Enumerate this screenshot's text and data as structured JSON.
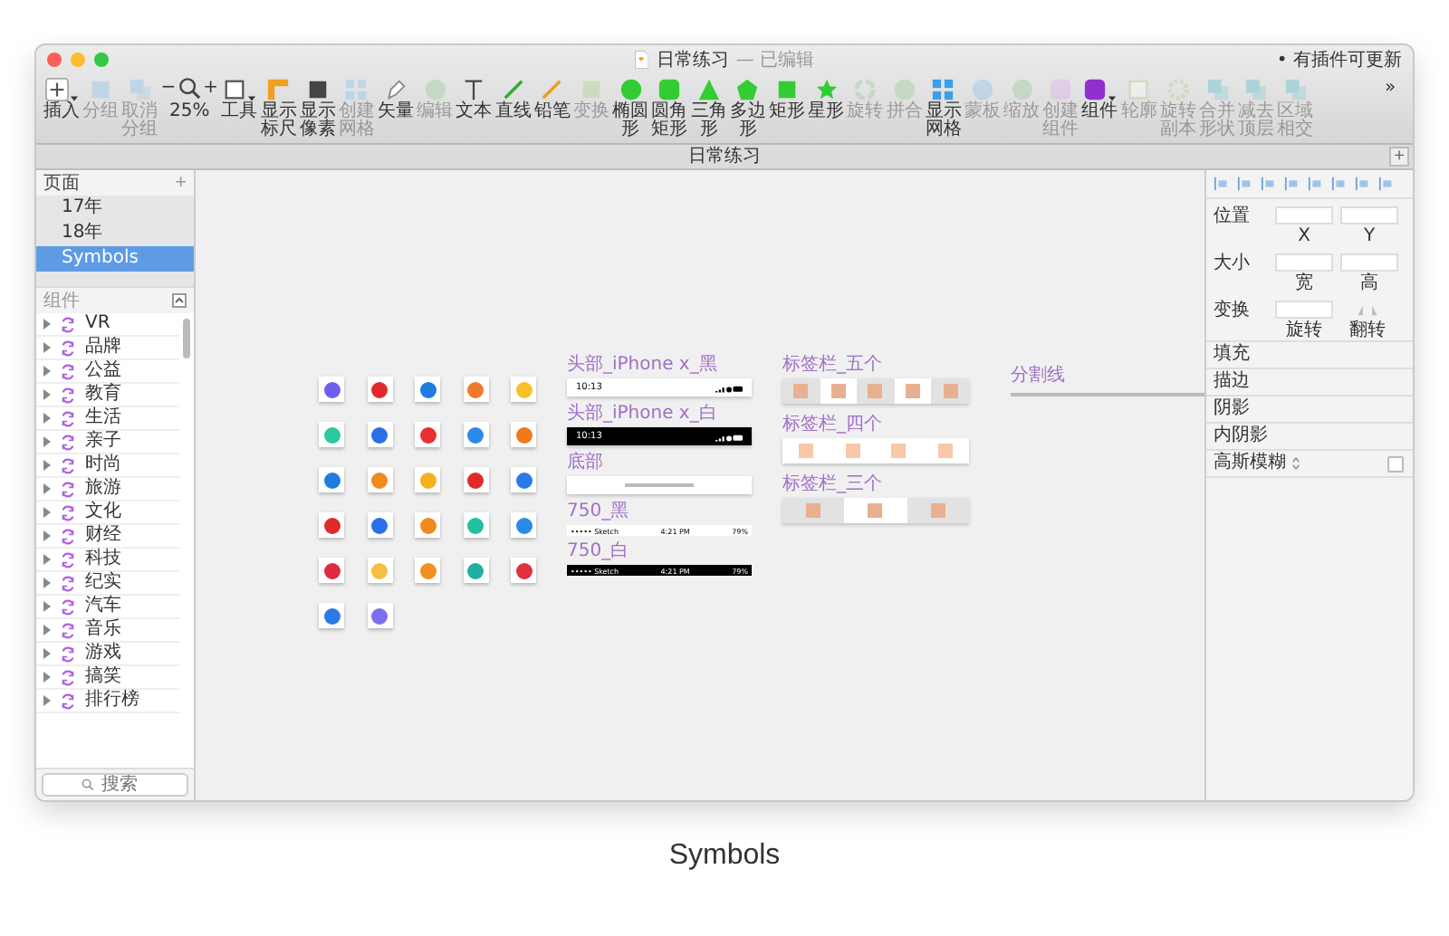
{
  "window": {
    "title": "日常练习",
    "status": "— 已编辑",
    "notice": "• 有插件可更新"
  },
  "toolbar": {
    "items": [
      {
        "kind": "insert",
        "label": "插入",
        "disabled": false,
        "has_menu": true
      },
      {
        "kind": "group",
        "label": "分组",
        "disabled": true,
        "has_menu": false
      },
      {
        "kind": "ungroup",
        "label": "取消分组",
        "disabled": true,
        "has_menu": false
      },
      {
        "kind": "zoom",
        "label": "25%",
        "minus": "−",
        "plus": "+",
        "disabled": false,
        "has_menu": false
      },
      {
        "kind": "tools",
        "label": "工具",
        "disabled": false,
        "has_menu": true
      },
      {
        "kind": "ruler",
        "label": "显示标尺",
        "disabled": false,
        "has_menu": false
      },
      {
        "kind": "pixels",
        "label": "显示像素",
        "disabled": false,
        "has_menu": false
      },
      {
        "kind": "grid",
        "label": "创建网格",
        "disabled": true,
        "has_menu": false
      },
      {
        "kind": "vector",
        "label": "矢量",
        "disabled": false,
        "has_menu": false
      },
      {
        "kind": "edit",
        "label": "编辑",
        "disabled": true,
        "has_menu": false
      },
      {
        "kind": "text",
        "label": "文本",
        "disabled": false,
        "has_menu": false
      },
      {
        "kind": "line",
        "label": "直线",
        "disabled": false,
        "has_menu": false
      },
      {
        "kind": "pencil",
        "label": "铅笔",
        "disabled": false,
        "has_menu": false
      },
      {
        "kind": "transform",
        "label": "变换",
        "disabled": true,
        "has_menu": false
      },
      {
        "kind": "oval",
        "label": "椭圆形",
        "disabled": false,
        "has_menu": false
      },
      {
        "kind": "rounded-rect",
        "label": "圆角矩形",
        "disabled": false,
        "has_menu": false
      },
      {
        "kind": "triangle",
        "label": "三角形",
        "disabled": false,
        "has_menu": false
      },
      {
        "kind": "polygon",
        "label": "多边形",
        "disabled": false,
        "has_menu": false
      },
      {
        "kind": "rect",
        "label": "矩形",
        "disabled": false,
        "has_menu": false
      },
      {
        "kind": "star",
        "label": "星形",
        "disabled": false,
        "has_menu": false
      },
      {
        "kind": "rotate",
        "label": "旋转",
        "disabled": true,
        "has_menu": false
      },
      {
        "kind": "flatten",
        "label": "拼合",
        "disabled": true,
        "has_menu": false
      },
      {
        "kind": "show-grid",
        "label": "显示网格",
        "disabled": false,
        "has_menu": false
      },
      {
        "kind": "mask",
        "label": "蒙板",
        "disabled": true,
        "has_menu": false
      },
      {
        "kind": "scale",
        "label": "缩放",
        "disabled": true,
        "has_menu": false
      },
      {
        "kind": "create-symbol",
        "label": "创建组件",
        "disabled": true,
        "has_menu": false
      },
      {
        "kind": "symbol",
        "label": "组件",
        "disabled": false,
        "has_menu": true
      },
      {
        "kind": "outline",
        "label": "轮廓",
        "disabled": true,
        "has_menu": false
      },
      {
        "kind": "rotate-copy",
        "label": "旋转副本",
        "disabled": true,
        "has_menu": false
      },
      {
        "kind": "union",
        "label": "合并形状",
        "disabled": true,
        "has_menu": false
      },
      {
        "kind": "subtract",
        "label": "减去顶层",
        "disabled": true,
        "has_menu": false
      },
      {
        "kind": "intersect",
        "label": "区域相交",
        "disabled": true,
        "has_menu": false
      }
    ],
    "overflow": "»"
  },
  "document_tab": {
    "title": "日常练习",
    "add": "+"
  },
  "pages": {
    "title": "页面",
    "add": "+",
    "items": [
      {
        "label": "17年",
        "selected": false
      },
      {
        "label": "18年",
        "selected": false
      },
      {
        "label": "Symbols",
        "selected": true
      }
    ]
  },
  "layers": {
    "title": "组件",
    "items": [
      "VR",
      "品牌",
      "公益",
      "教育",
      "生活",
      "亲子",
      "时尚",
      "旅游",
      "文化",
      "财经",
      "科技",
      "纪实",
      "汽车",
      "音乐",
      "游戏",
      "搞笑",
      "排行榜"
    ],
    "search": {
      "placeholder": "搜索"
    }
  },
  "canvas": {
    "icon_tiles": [
      {
        "color": "#6f5ff0"
      },
      {
        "color": "#e02a2a"
      },
      {
        "color": "#1e7be0"
      },
      {
        "color": "#f07a2a"
      },
      {
        "color": "#f5c02a"
      },
      {
        "color": "#2ac9a0"
      },
      {
        "color": "#2a6fe8"
      },
      {
        "color": "#e83030"
      },
      {
        "color": "#2a8ae8"
      },
      {
        "color": "#f07a1a"
      },
      {
        "color": "#1e7be0"
      },
      {
        "color": "#f08a20"
      },
      {
        "color": "#f5b020"
      },
      {
        "color": "#e02a2a"
      },
      {
        "color": "#2a7ae8"
      },
      {
        "color": "#e02a2a"
      },
      {
        "color": "#2a6fe8"
      },
      {
        "color": "#f08a20"
      },
      {
        "color": "#20c0a0"
      },
      {
        "color": "#2a8ae8"
      },
      {
        "color": "#e02a40"
      },
      {
        "color": "#f5c040"
      },
      {
        "color": "#f09020"
      },
      {
        "color": "#20b0a0"
      },
      {
        "color": "#e03040"
      },
      {
        "color": "#2a7ae8"
      },
      {
        "color": "#7a6ff0"
      }
    ],
    "status_symbols": [
      {
        "kind": "notch",
        "label": "头部_iPhone x_黑",
        "dark": false,
        "time": "10:13"
      },
      {
        "kind": "notch",
        "label": "头部_iPhone x_白",
        "dark": true,
        "time": "10:13"
      },
      {
        "kind": "home",
        "label": "底部",
        "dark": false
      },
      {
        "kind": "legacy",
        "label": "750_黑",
        "dark": false,
        "carrier": "••••• Sketch",
        "time": "4:21 PM",
        "battery": "79%"
      },
      {
        "kind": "legacy",
        "label": "750_白",
        "dark": true,
        "carrier": "••••• Sketch",
        "time": "4:21 PM",
        "battery": "79%"
      }
    ],
    "tab_bars": [
      {
        "label": "标签栏_五个",
        "color": "#e8b090",
        "cells": [
          {
            "shaded": true
          },
          {
            "shaded": false
          },
          {
            "shaded": true
          },
          {
            "shaded": false
          },
          {
            "shaded": true
          }
        ]
      },
      {
        "label": "标签栏_四个",
        "color": "#f8c8a8",
        "cells": [
          {
            "shaded": false
          },
          {
            "shaded": false
          },
          {
            "shaded": false
          },
          {
            "shaded": false
          }
        ]
      },
      {
        "label": "标签栏_三个",
        "color": "#e8b090",
        "cells": [
          {
            "shaded": true
          },
          {
            "shaded": false
          },
          {
            "shaded": true
          }
        ]
      }
    ],
    "divider": {
      "label": "分割线"
    }
  },
  "inspector": {
    "rows": [
      {
        "label": "位置",
        "fields": [
          "X",
          "Y"
        ]
      },
      {
        "label": "大小",
        "fields": [
          "宽",
          "高"
        ]
      },
      {
        "label": "变换",
        "fields": [
          "旋转",
          "翻转"
        ]
      }
    ],
    "sections": [
      {
        "label": "填充"
      },
      {
        "label": "描边"
      },
      {
        "label": "阴影"
      },
      {
        "label": "内阴影"
      }
    ],
    "blur": {
      "label": "高斯模糊",
      "checked": false
    }
  },
  "caption": "Symbols"
}
